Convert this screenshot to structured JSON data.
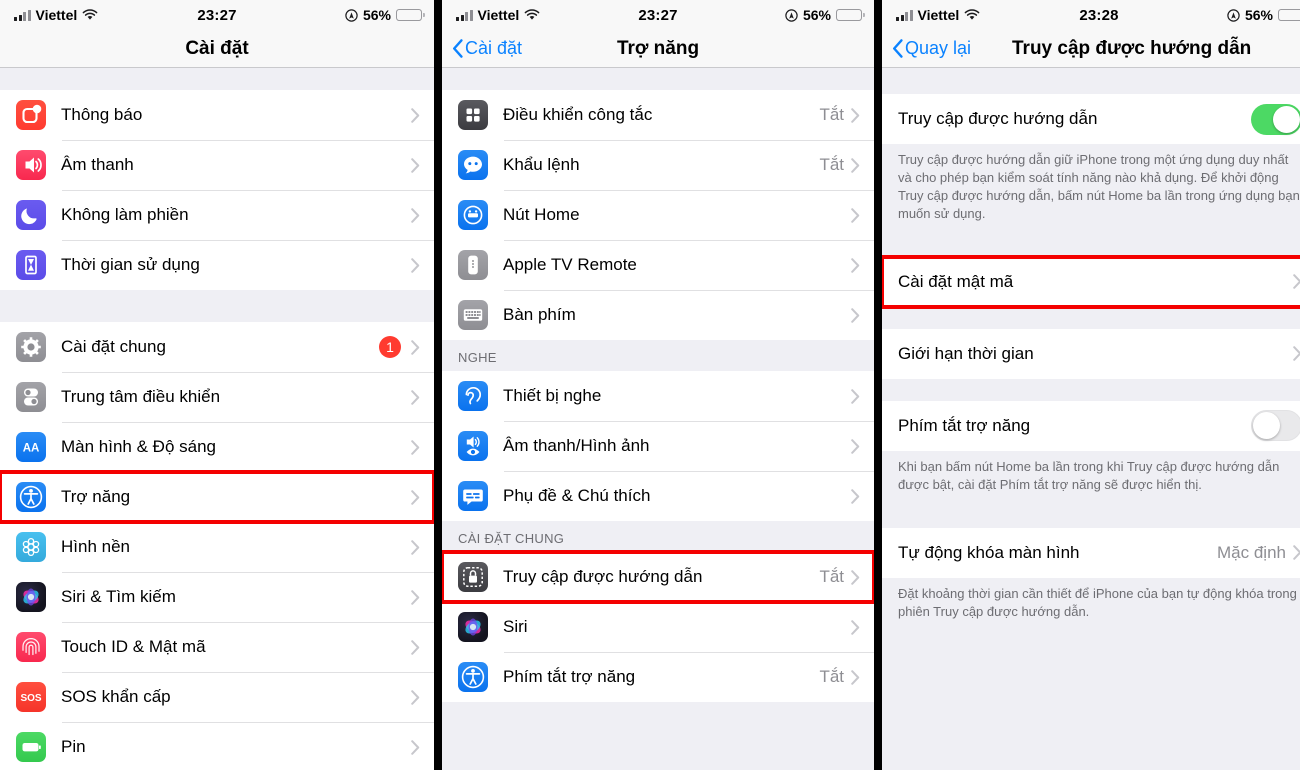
{
  "panels": [
    {
      "id": "settings",
      "statusbar": {
        "carrier": "Viettel",
        "time": "23:27",
        "battery_pct": "56%"
      },
      "nav": {
        "title": "Cài đặt",
        "back": ""
      },
      "groups": [
        {
          "rows": [
            {
              "label": "Thông báo",
              "icon": "notifications-icon",
              "chevron": true
            },
            {
              "label": "Âm thanh",
              "icon": "sound-icon",
              "chevron": true
            },
            {
              "label": "Không làm phiền",
              "icon": "moon-icon",
              "chevron": true
            },
            {
              "label": "Thời gian sử dụng",
              "icon": "hourglass-icon",
              "chevron": true
            }
          ]
        },
        {
          "rows": [
            {
              "label": "Cài đặt chung",
              "icon": "gear-icon",
              "badge": "1",
              "chevron": true
            },
            {
              "label": "Trung tâm điều khiển",
              "icon": "control-center-icon",
              "chevron": true
            },
            {
              "label": "Màn hình & Độ sáng",
              "icon": "display-brightness-icon",
              "chevron": true
            },
            {
              "label": "Trợ năng",
              "icon": "accessibility-icon",
              "chevron": true,
              "highlight": true
            },
            {
              "label": "Hình nền",
              "icon": "wallpaper-icon",
              "chevron": true
            },
            {
              "label": "Siri & Tìm kiếm",
              "icon": "siri-icon",
              "chevron": true
            },
            {
              "label": "Touch ID & Mật mã",
              "icon": "touch-id-icon",
              "chevron": true
            },
            {
              "label": "SOS khẩn cấp",
              "icon": "sos-icon",
              "chevron": true
            },
            {
              "label": "Pin",
              "icon": "battery-icon",
              "chevron": true
            }
          ]
        }
      ]
    },
    {
      "id": "accessibility",
      "statusbar": {
        "carrier": "Viettel",
        "time": "23:27",
        "battery_pct": "56%"
      },
      "nav": {
        "title": "Trợ năng",
        "back": "Cài đặt"
      },
      "groups": [
        {
          "rows": [
            {
              "label": "Điều khiển công tắc",
              "icon": "switch-control-icon",
              "value": "Tắt",
              "chevron": true
            },
            {
              "label": "Khẩu lệnh",
              "icon": "voice-control-icon",
              "value": "Tắt",
              "chevron": true
            },
            {
              "label": "Nút Home",
              "icon": "home-button-icon",
              "chevron": true
            },
            {
              "label": "Apple TV Remote",
              "icon": "apple-tv-remote-icon",
              "chevron": true
            },
            {
              "label": "Bàn phím",
              "icon": "keyboard-icon",
              "chevron": true
            }
          ]
        },
        {
          "header": "NGHE",
          "rows": [
            {
              "label": "Thiết bị nghe",
              "icon": "hearing-devices-icon",
              "chevron": true
            },
            {
              "label": "Âm thanh/Hình ảnh",
              "icon": "audio-visual-icon",
              "chevron": true
            },
            {
              "label": "Phụ đề & Chú thích",
              "icon": "subtitles-icon",
              "chevron": true
            }
          ]
        },
        {
          "header": "CÀI ĐẶT CHUNG",
          "rows": [
            {
              "label": "Truy cập được hướng dẫn",
              "icon": "guided-access-icon",
              "value": "Tắt",
              "chevron": true,
              "highlight": true
            },
            {
              "label": "Siri",
              "icon": "siri-icon",
              "chevron": true
            },
            {
              "label": "Phím tắt trợ năng",
              "icon": "accessibility-icon",
              "value": "Tắt",
              "chevron": true
            }
          ]
        }
      ]
    },
    {
      "id": "guided-access",
      "statusbar": {
        "carrier": "Viettel",
        "time": "23:28",
        "battery_pct": "56%"
      },
      "nav": {
        "title": "Truy cập được hướng dẫn",
        "back": "Quay lại"
      },
      "groups": [
        {
          "rows": [
            {
              "label": "Truy cập được hướng dẫn",
              "toggle": "on"
            }
          ],
          "footnote": "Truy cập được hướng dẫn giữ iPhone trong một ứng dụng duy nhất và cho phép bạn kiểm soát tính năng nào khả dụng. Để khởi động Truy cập được hướng dẫn, bấm nút Home ba lần trong ứng dụng bạn muốn sử dụng."
        },
        {
          "rows": [
            {
              "label": "Cài đặt mật mã",
              "chevron": true,
              "highlight": true
            }
          ]
        },
        {
          "rows": [
            {
              "label": "Giới hạn thời gian",
              "chevron": true
            }
          ]
        },
        {
          "rows": [
            {
              "label": "Phím tắt trợ năng",
              "toggle": "off"
            }
          ],
          "footnote": "Khi bạn bấm nút Home ba lần trong khi Truy cập được hướng dẫn được bật, cài đặt Phím tắt trợ năng sẽ được hiển thị."
        },
        {
          "rows": [
            {
              "label": "Tự động khóa màn hình",
              "value": "Mặc định",
              "chevron": true
            }
          ],
          "footnote": "Đặt khoảng thời gian cần thiết để iPhone của bạn tự động khóa trong phiên Truy cập được hướng dẫn."
        }
      ]
    }
  ],
  "colors": {
    "accent_blue": "#0a82ff",
    "highlight_red": "#f40000",
    "toggle_on_green": "#4cd964",
    "badge_red": "#ff3b30",
    "group_bg": "#efeff4"
  }
}
